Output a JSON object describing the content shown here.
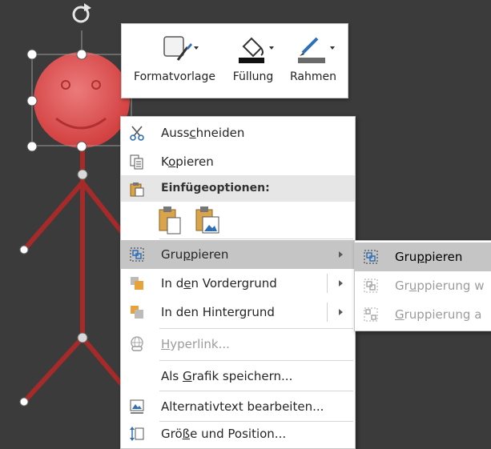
{
  "mini_toolbar": {
    "buttons": [
      {
        "label": "Formatvorlage",
        "icon": "format-style-icon"
      },
      {
        "label": "Füllung",
        "icon": "fill-bucket-icon"
      },
      {
        "label": "Rahmen",
        "icon": "outline-pen-icon"
      }
    ]
  },
  "context_menu": {
    "cut": {
      "pre": "Auss",
      "key": "c",
      "post": "hneiden"
    },
    "copy": {
      "pre": "K",
      "key": "o",
      "post": "pieren"
    },
    "paste_section": "Einfügeoptionen:",
    "group": {
      "pre": "Gru",
      "key": "p",
      "post": "pieren"
    },
    "bring_front": {
      "pre": "In d",
      "key": "e",
      "post": "n Vordergrund"
    },
    "send_back": {
      "pre": "In den Hinter",
      "key": "g",
      "post": "rund"
    },
    "hyperlink": {
      "pre": "",
      "key": "H",
      "post": "yperlink..."
    },
    "save_as_picture": {
      "pre": "Als ",
      "key": "G",
      "post": "rafik speichern..."
    },
    "alt_text": {
      "pre": "Alternativtext bearbeiten...",
      "key": "",
      "post": ""
    },
    "size_position": {
      "pre": "Grö",
      "key": "ß",
      "post": "e und Position..."
    }
  },
  "submenu": {
    "group": {
      "pre": "Gru",
      "key": "p",
      "post": "pieren"
    },
    "regroup": {
      "pre": "Gr",
      "key": "u",
      "post": "ppierung w"
    },
    "ungroup": {
      "pre": "",
      "key": "G",
      "post": "ruppierung a"
    }
  },
  "colors": {
    "accent_fill": "#e05555",
    "stick_figure": "#a52a2a",
    "highlight": "#c5c5c5",
    "icon_blue": "#2e6fb8"
  }
}
